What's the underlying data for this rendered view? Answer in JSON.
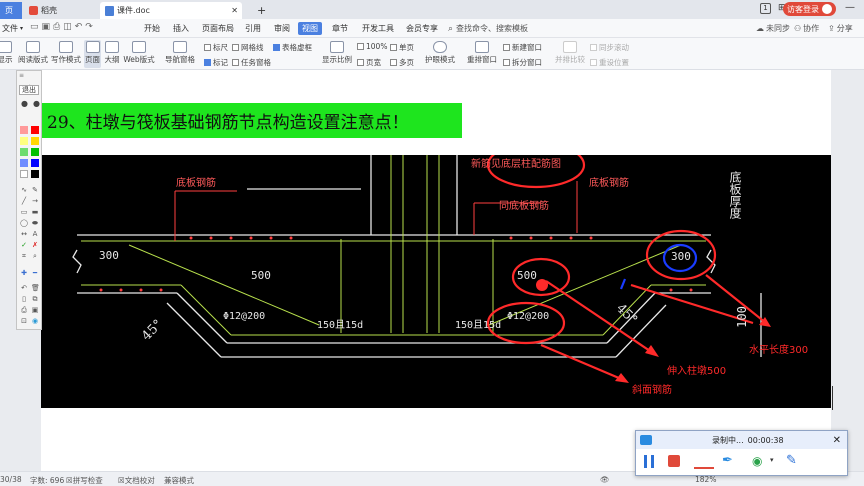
{
  "titlebar": {
    "tab_home": "页",
    "tab_wps": "稻壳",
    "tab_doc": "课件.doc",
    "login_label": "访客登录",
    "window_badge": "1"
  },
  "menubar": {
    "file_label": "文件",
    "items": [
      "开始",
      "插入",
      "页面布局",
      "引用",
      "审阅",
      "视图",
      "章节",
      "开发工具",
      "会员专享"
    ],
    "active_item": "视图",
    "search_label": "查找命令、搜索模板",
    "sync_label": "未同步",
    "collab_label": "协作",
    "share_label": "分享"
  },
  "ribbon": {
    "buttons": [
      "显示",
      "阅读版式",
      "写作模式",
      "页面",
      "大纲",
      "Web版式",
      "导航窗格",
      "显示比例",
      "页宽",
      "多页",
      "护眼模式",
      "重排窗口",
      "拆分窗口",
      "并排比较",
      "重设位置"
    ],
    "checks": [
      {
        "label": "标尺",
        "on": false
      },
      {
        "label": "网格线",
        "on": false
      },
      {
        "label": "表格虚框",
        "on": true
      },
      {
        "label": "标记",
        "on": true
      },
      {
        "label": "任务窗格",
        "on": false
      }
    ],
    "zoom_label": "100%",
    "single_page": "单页",
    "new_window": "新建窗口",
    "sync_scroll": "同步滚动"
  },
  "document": {
    "heading": "29、柱墩与筏板基础钢筋节点构造设置注意点！"
  },
  "cad": {
    "labels": {
      "bottom_rebar": "底板钢筋",
      "side_rebar": "同底板钢筋",
      "column_rebar": "新筋见底层柱配筋图",
      "thickness": "底板厚度",
      "dim_300a": "300",
      "dim_300b": "300",
      "dim_500a": "500",
      "dim_500b": "500",
      "dim_100": "100",
      "angle_left": "45°",
      "angle_right": "45°",
      "bar_a": "Φ12@200",
      "bar_b": "Φ12@200",
      "anchor_a": "150且15d",
      "anchor_b": "150且15d"
    },
    "notes": {
      "horizontal": "水平长度300",
      "into_pier": "伸入柱墩500",
      "slope_bar": "斜面钢筋"
    }
  },
  "toolpanel": {
    "exit_label": "退出",
    "colors": [
      "#ffffff",
      "#ff0000",
      "#ffff00",
      "#ffcc00",
      "#00cc00",
      "#00ff00",
      "#0000ff",
      "#0066ff",
      "#ffffff",
      "#000000"
    ]
  },
  "statusbar": {
    "page": "30/38",
    "words": "字数: 696",
    "spell": "拼写检查",
    "compare": "文档校对",
    "compat": "兼容模式",
    "zoom": "182%"
  },
  "recorder": {
    "title": "录制中...",
    "time": "00:00:38"
  },
  "colors": {
    "accent": "#4b80e0",
    "heading_bg": "#1ee51e",
    "annotation_red": "#ff2a2a",
    "cad_green": "#9ed25a",
    "cad_white": "#e8e8e8"
  }
}
